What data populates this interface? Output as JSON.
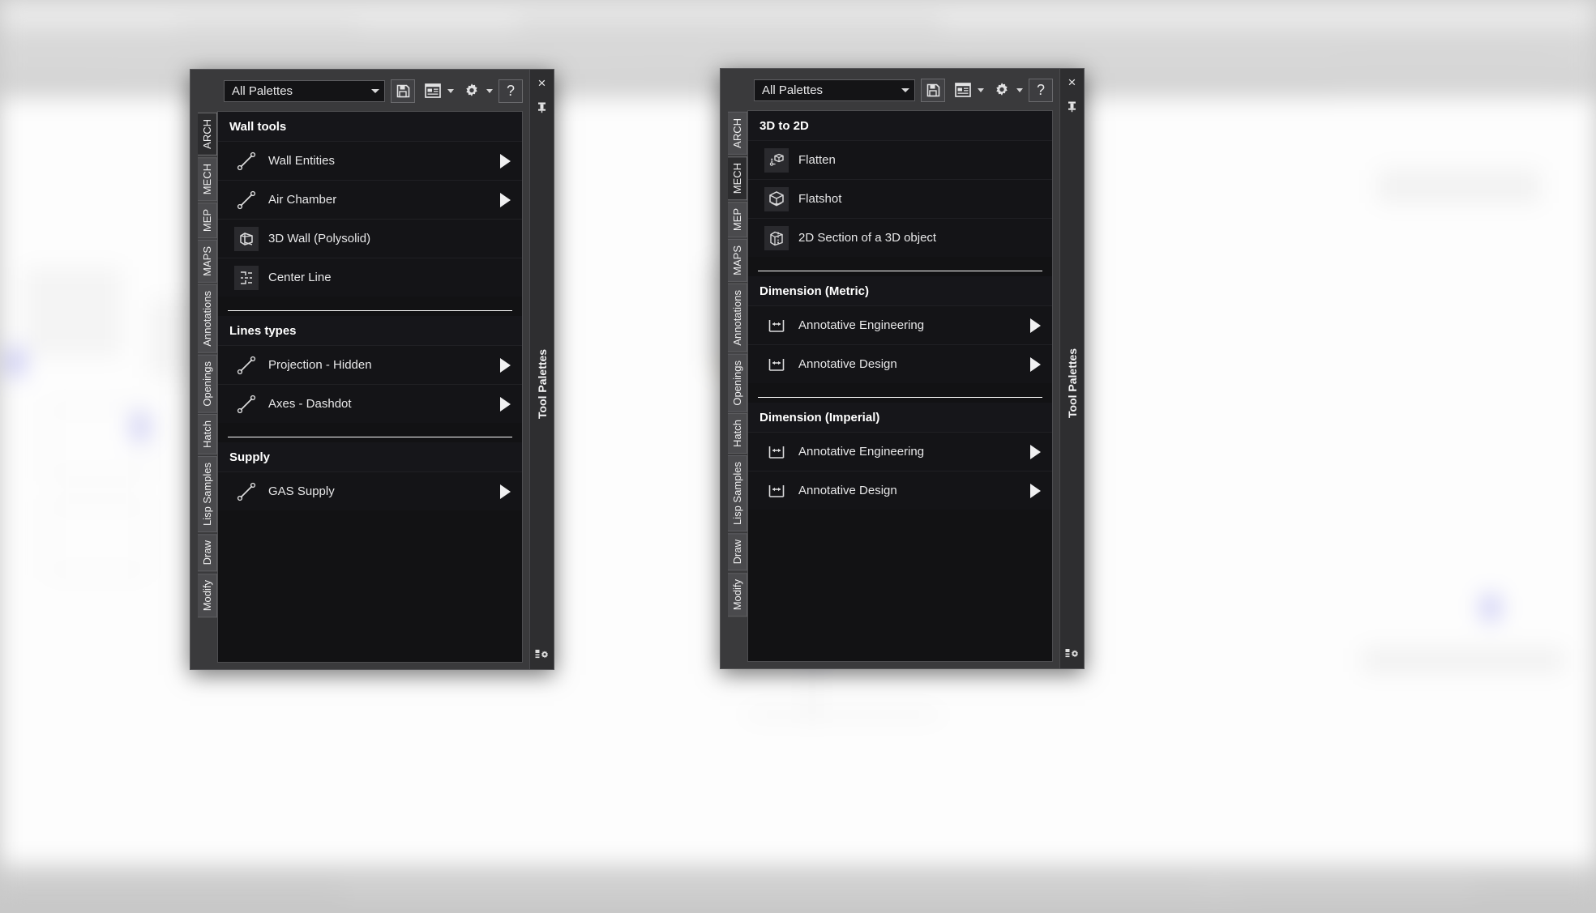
{
  "app": {
    "window_label": "Tool Palettes"
  },
  "palettes": [
    {
      "id": "left-palette",
      "dropdown": {
        "value": "All Palettes",
        "icon": "chevron-down-icon"
      },
      "toolbar": [
        {
          "name": "save-palette-button",
          "icon": "floppy-disk-icon",
          "label": "Save"
        },
        {
          "name": "palette-view-button",
          "icon": "palette-view-icon",
          "label": "View",
          "has_dropdown": true
        },
        {
          "name": "properties-button",
          "icon": "gear-icon",
          "label": "Properties",
          "has_dropdown": true
        },
        {
          "name": "help-button",
          "icon": "question-mark-icon",
          "label": "?"
        }
      ],
      "tabs": [
        {
          "label": "ARCH",
          "active": true
        },
        {
          "label": "MECH",
          "active": false
        },
        {
          "label": "MEP",
          "active": false
        },
        {
          "label": "MAPS",
          "active": false
        },
        {
          "label": "Annotations",
          "active": false
        },
        {
          "label": "Openings",
          "active": false
        },
        {
          "label": "Hatch",
          "active": false
        },
        {
          "label": "Lisp Samples",
          "active": false
        },
        {
          "label": "Draw",
          "active": false
        },
        {
          "label": "Modify",
          "active": false
        }
      ],
      "sections": [
        {
          "header": "Wall tools",
          "divider_after": true,
          "items": [
            {
              "label": "Wall Entities",
              "icon": "line-segment-icon",
              "boxed": false,
              "has_flyout": true
            },
            {
              "label": "Air Chamber",
              "icon": "line-segment-icon",
              "boxed": false,
              "has_flyout": true
            },
            {
              "label": "3D Wall (Polysolid)",
              "icon": "polysolid-3d-icon",
              "boxed": true,
              "has_flyout": false
            },
            {
              "label": "Center Line",
              "icon": "center-line-icon",
              "boxed": true,
              "has_flyout": false
            }
          ]
        },
        {
          "header": "Lines types",
          "divider_after": true,
          "items": [
            {
              "label": "Projection - Hidden",
              "icon": "line-segment-icon",
              "boxed": false,
              "has_flyout": true
            },
            {
              "label": "Axes - Dashdot",
              "icon": "line-segment-icon",
              "boxed": false,
              "has_flyout": true
            }
          ]
        },
        {
          "header": "Supply",
          "divider_after": false,
          "items": [
            {
              "label": "GAS Supply",
              "icon": "line-segment-icon",
              "boxed": false,
              "has_flyout": true
            }
          ]
        }
      ],
      "titlestrip": {
        "close": "×",
        "pin_icon": "pushpin-icon",
        "label": "Tool Palettes",
        "bottom_icon": "tool-palettes-icon"
      }
    },
    {
      "id": "right-palette",
      "dropdown": {
        "value": "All Palettes",
        "icon": "chevron-down-icon"
      },
      "toolbar": [
        {
          "name": "save-palette-button",
          "icon": "floppy-disk-icon",
          "label": "Save"
        },
        {
          "name": "palette-view-button",
          "icon": "palette-view-icon",
          "label": "View",
          "has_dropdown": true
        },
        {
          "name": "properties-button",
          "icon": "gear-icon",
          "label": "Properties",
          "has_dropdown": true
        },
        {
          "name": "help-button",
          "icon": "question-mark-icon",
          "label": "?"
        }
      ],
      "tabs": [
        {
          "label": "ARCH",
          "active": false
        },
        {
          "label": "MECH",
          "active": true
        },
        {
          "label": "MEP",
          "active": false
        },
        {
          "label": "MAPS",
          "active": false
        },
        {
          "label": "Annotations",
          "active": false
        },
        {
          "label": "Openings",
          "active": false
        },
        {
          "label": "Hatch",
          "active": false
        },
        {
          "label": "Lisp Samples",
          "active": false
        },
        {
          "label": "Draw",
          "active": false
        },
        {
          "label": "Modify",
          "active": false
        }
      ],
      "sections": [
        {
          "header": "3D to 2D",
          "divider_after": true,
          "items": [
            {
              "label": "Flatten",
              "icon": "flatten-icon",
              "boxed": true,
              "has_flyout": false
            },
            {
              "label": "Flatshot",
              "icon": "flatshot-icon",
              "boxed": true,
              "has_flyout": false
            },
            {
              "label": "2D Section of a 3D object",
              "icon": "section-3d-icon",
              "boxed": true,
              "has_flyout": false
            }
          ]
        },
        {
          "header": "Dimension (Metric)",
          "divider_after": true,
          "items": [
            {
              "label": "Annotative Engineering",
              "icon": "dimension-icon",
              "boxed": false,
              "has_flyout": true
            },
            {
              "label": "Annotative Design",
              "icon": "dimension-icon",
              "boxed": false,
              "has_flyout": true
            }
          ]
        },
        {
          "header": "Dimension (Imperial)",
          "divider_after": false,
          "items": [
            {
              "label": "Annotative Engineering",
              "icon": "dimension-icon",
              "boxed": false,
              "has_flyout": true
            },
            {
              "label": "Annotative Design",
              "icon": "dimension-icon",
              "boxed": false,
              "has_flyout": true
            }
          ]
        }
      ],
      "titlestrip": {
        "close": "×",
        "pin_icon": "pushpin-icon",
        "label": "Tool Palettes",
        "bottom_icon": "tool-palettes-icon"
      }
    }
  ],
  "colors": {
    "frame": "#3a3a3c",
    "content_bg": "#121214",
    "row_bg": "#141417",
    "tab_bg": "#4a4a4d",
    "tab_active_bg": "#2c2c2e",
    "text": "#e7e7e8",
    "header_text": "#ffffff",
    "divider": "#ffffff",
    "accent_blue": "#b9b9f2"
  }
}
